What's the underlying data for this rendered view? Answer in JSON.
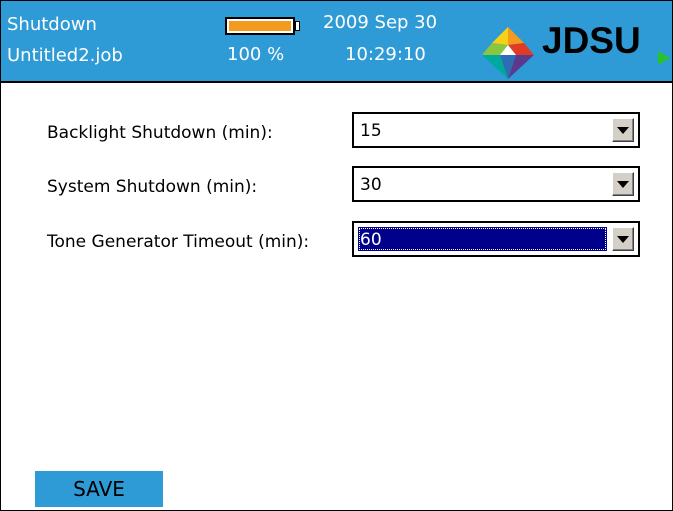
{
  "header": {
    "title": "Shutdown",
    "job_name": "Untitled2.job",
    "battery_percent_label": "100 %",
    "battery_level": 1.0,
    "date": "2009 Sep 30",
    "time": "10:29:10",
    "brand": "JDSU",
    "logo_icon": "jdsu-prism-logo-icon",
    "accent_color": "#2e9bd6",
    "battery_fill_color": "#f49b1f"
  },
  "settings": [
    {
      "label": "Backlight Shutdown (min):",
      "value": "15"
    },
    {
      "label": "System Shutdown (min):",
      "value": "30"
    },
    {
      "label": "Tone Generator Timeout (min):",
      "value": "60",
      "focused": true
    }
  ],
  "actions": {
    "save_label": "SAVE"
  }
}
